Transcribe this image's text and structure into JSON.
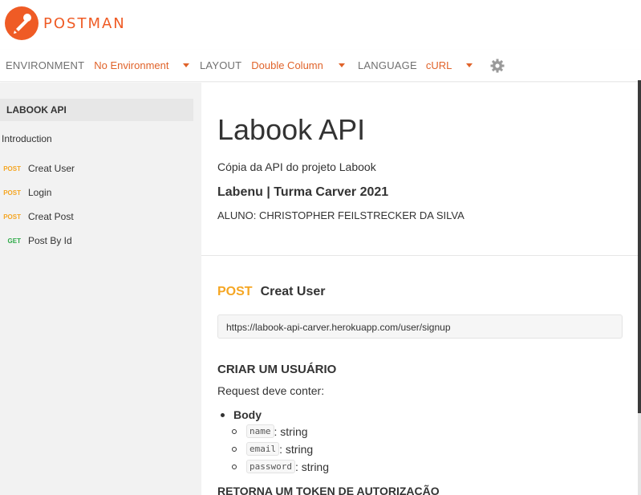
{
  "brand": {
    "name": "POSTMAN",
    "color": "#ef5b25",
    "icon": "postman-logo-icon"
  },
  "topbar": {
    "environment": {
      "label": "ENVIRONMENT",
      "value": "No Environment"
    },
    "layout": {
      "label": "LAYOUT",
      "value": "Double Column"
    },
    "language": {
      "label": "LANGUAGE",
      "value": "cURL"
    },
    "settings_icon": "gear-icon"
  },
  "sidebar": {
    "collection": "LABOOK API",
    "intro": "Introduction",
    "items": [
      {
        "method": "POST",
        "label": "Creat User"
      },
      {
        "method": "POST",
        "label": "Login"
      },
      {
        "method": "POST",
        "label": "Creat Post"
      },
      {
        "method": "GET",
        "label": "Post By Id"
      }
    ]
  },
  "main": {
    "title": "Labook API",
    "description": "Cópia da API do projeto Labook",
    "org": "Labenu | Turma Carver 2021",
    "student": "ALUNO: CHRISTOPHER FEILSTRECKER DA SILVA",
    "request": {
      "method": "POST",
      "name": "Creat User",
      "url": "https://labook-api-carver.herokuapp.com/user/signup",
      "section_title": "CRIAR UM USUÁRIO",
      "note": "Request deve conter:",
      "body_label": "Body",
      "fields": [
        {
          "name": "name",
          "type": ": string"
        },
        {
          "name": "email",
          "type": ": string"
        },
        {
          "name": "password",
          "type": ": string"
        }
      ],
      "returns_title": "RETORNA UM TOKEN DE AUTORIZAÇÃO"
    }
  },
  "colors": {
    "accent": "#e0632a",
    "post": "#f5a623",
    "get": "#2eaa48"
  }
}
